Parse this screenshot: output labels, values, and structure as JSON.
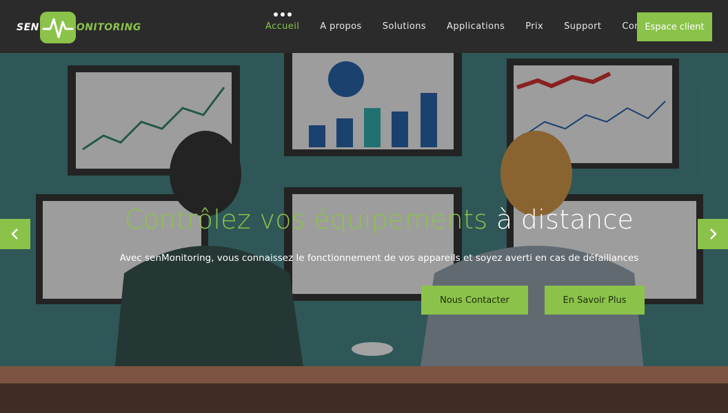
{
  "brand": {
    "logo_prefix": "SEN",
    "logo_suffix": "ONITORING",
    "accent": "#8bc34a"
  },
  "nav": {
    "items": [
      {
        "label": "Accueil",
        "active": true
      },
      {
        "label": "A propos"
      },
      {
        "label": "Solutions"
      },
      {
        "label": "Applications"
      },
      {
        "label": "Prix"
      },
      {
        "label": "Support"
      },
      {
        "label": "Contact"
      }
    ],
    "cta": "Espace client"
  },
  "hero": {
    "title_green": "Contrôlez vos équipements",
    "title_white": "à distance",
    "subtitle": "Avec senMonitoring, vous connaissez le fonctionnement de vos appareils et soyez averti en cas de défaillances",
    "buttons": {
      "contact": "Nous Contacter",
      "more": "En Savoir Plus"
    },
    "icons": {
      "prev": "chevron-left-icon",
      "next": "chevron-right-icon"
    }
  }
}
